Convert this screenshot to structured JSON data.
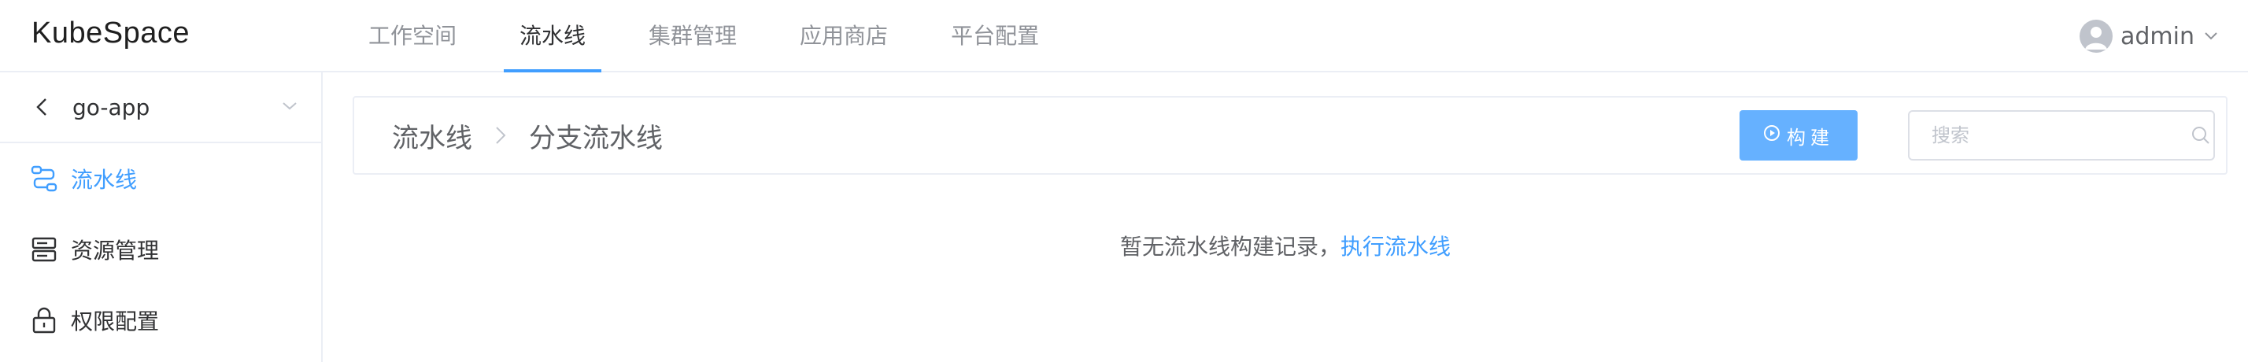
{
  "app": {
    "logo": "KubeSpace"
  },
  "nav": {
    "items": [
      {
        "label": "工作空间",
        "active": false
      },
      {
        "label": "流水线",
        "active": true
      },
      {
        "label": "集群管理",
        "active": false
      },
      {
        "label": "应用商店",
        "active": false
      },
      {
        "label": "平台配置",
        "active": false
      }
    ]
  },
  "user": {
    "name": "admin",
    "avatar_icon": "user-avatar-icon",
    "dropdown_icon": "chevron-down-icon"
  },
  "sidebar": {
    "project": {
      "name": "go-app",
      "back_icon": "chevron-left-icon",
      "dropdown_icon": "chevron-down-icon"
    },
    "items": [
      {
        "label": "流水线",
        "icon": "pipeline-icon",
        "active": true
      },
      {
        "label": "资源管理",
        "icon": "server-icon",
        "active": false
      },
      {
        "label": "权限配置",
        "icon": "lock-icon",
        "active": false
      }
    ]
  },
  "main": {
    "breadcrumb": {
      "root": "流水线",
      "current": "分支流水线"
    },
    "build_button": {
      "label": "构建",
      "icon": "play-circle-icon"
    },
    "search": {
      "placeholder": "搜索",
      "value": ""
    },
    "empty": {
      "text": "暂无流水线构建记录，",
      "link": "执行流水线"
    }
  },
  "colors": {
    "primary": "#409eff",
    "primary_light": "#66b1ff",
    "border": "#ebeef5",
    "text_muted": "#909399"
  }
}
